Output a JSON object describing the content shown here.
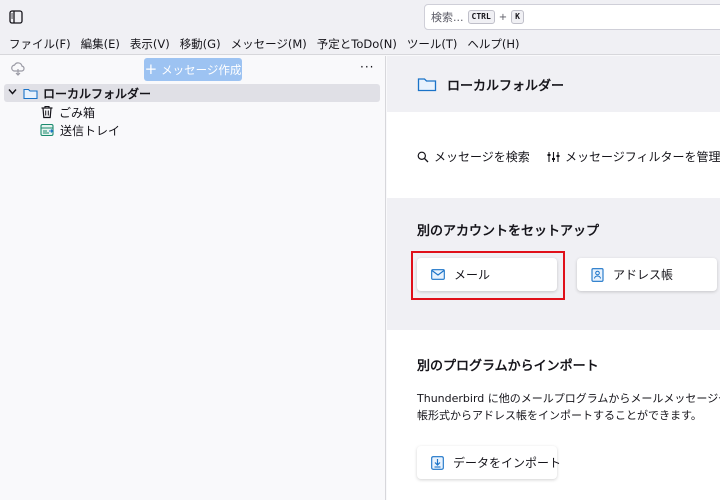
{
  "toolbar": {
    "search_placeholder": "検索...",
    "shortcut_ctrl": "CTRL",
    "shortcut_plus": "+",
    "shortcut_key": "K"
  },
  "menubar": {
    "items": [
      "ファイル(F)",
      "編集(E)",
      "表示(V)",
      "移動(G)",
      "メッセージ(M)",
      "予定とToDo(N)",
      "ツール(T)",
      "ヘルプ(H)"
    ]
  },
  "folder_pane": {
    "write_button": "メッセージ作成",
    "more": "···",
    "folders": [
      {
        "label": "ローカルフォルダー",
        "icon": "folder-icon"
      },
      {
        "label": "ごみ箱",
        "icon": "trash-icon"
      },
      {
        "label": "送信トレイ",
        "icon": "outbox-icon"
      }
    ]
  },
  "content": {
    "title": "ローカルフォルダー",
    "search_messages": "メッセージを検索",
    "manage_filters": "メッセージフィルターを管理",
    "setup_title": "別のアカウントをセットアップ",
    "mail_card": "メール",
    "addressbook_card": "アドレス帳",
    "import_title": "別のプログラムからインポート",
    "import_desc_line1": "Thunderbird に他のメールプログラムからメールメッセージやフィード購",
    "import_desc_line2": "帳形式からアドレス帳をインポートすることができます。",
    "import_button": "データをインポート"
  },
  "colors": {
    "accent": "#0061e0",
    "write_button_bg": "#9dc3f2",
    "highlight_border": "#e0101a",
    "folder_icon": "#1a73c8"
  }
}
